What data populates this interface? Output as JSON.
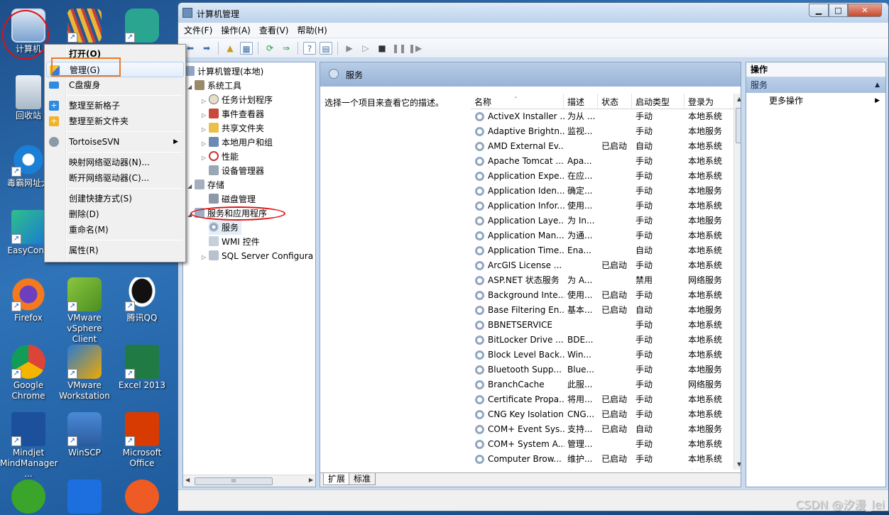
{
  "desktop": {
    "icons": [
      {
        "label": "计算机",
        "name": "computer-icon"
      },
      {
        "label": "",
        "name": "app-bars-icon"
      },
      {
        "label": "",
        "name": "app-green-icon"
      },
      {
        "label": "回收站",
        "name": "recycle-bin-icon"
      },
      {
        "label": "毒霸网址大",
        "name": "ie-browser-icon"
      },
      {
        "label": "EasyConn",
        "name": "easyconnect-icon"
      },
      {
        "label": "Firefox",
        "name": "firefox-icon"
      },
      {
        "label": "VMware vSphere Client",
        "name": "vmware-vsphere-icon"
      },
      {
        "label": "腾讯QQ",
        "name": "qq-icon"
      },
      {
        "label": "Google Chrome",
        "name": "chrome-icon"
      },
      {
        "label": "VMware Workstation",
        "name": "vmware-workstation-icon"
      },
      {
        "label": "Excel 2013",
        "name": "excel-icon"
      },
      {
        "label": "Mindjet MindManager ...",
        "name": "mindmanager-icon"
      },
      {
        "label": "WinSCP",
        "name": "winscp-icon"
      },
      {
        "label": "Microsoft Office",
        "name": "office-icon"
      },
      {
        "label": "",
        "name": "frog-app-icon"
      },
      {
        "label": "",
        "name": "shield-app-icon"
      },
      {
        "label": "",
        "name": "postman-icon"
      }
    ]
  },
  "context_menu": {
    "items": [
      {
        "label": "打开(O)",
        "bold": true
      },
      {
        "label": "管理(G)",
        "highlighted": true
      },
      {
        "label": "C盘瘦身"
      },
      {
        "label": "整理至新格子"
      },
      {
        "label": "整理至新文件夹"
      },
      {
        "label": "TortoiseSVN",
        "submenu": true
      },
      {
        "label": "映射网络驱动器(N)..."
      },
      {
        "label": "断开网络驱动器(C)..."
      },
      {
        "label": "创建快捷方式(S)"
      },
      {
        "label": "删除(D)"
      },
      {
        "label": "重命名(M)"
      },
      {
        "label": "属性(R)"
      }
    ]
  },
  "window": {
    "title": "计算机管理",
    "menu": [
      "文件(F)",
      "操作(A)",
      "查看(V)",
      "帮助(H)"
    ],
    "controls": {
      "minimize": "▁",
      "maximize": "□",
      "close": "✕"
    }
  },
  "tree": {
    "root": "计算机管理(本地)",
    "system_tools": "系统工具",
    "task_scheduler": "任务计划程序",
    "event_viewer": "事件查看器",
    "shared_folders": "共享文件夹",
    "local_users": "本地用户和组",
    "performance": "性能",
    "device_manager": "设备管理器",
    "storage": "存储",
    "disk_management": "磁盘管理",
    "services_apps": "服务和应用程序",
    "services": "服务",
    "wmi": "WMI 控件",
    "sql": "SQL Server Configura",
    "scroll_thumb": "III"
  },
  "services_pane": {
    "header": "服务",
    "description": "选择一个项目来查看它的描述。",
    "columns": [
      "名称",
      "描述",
      "状态",
      "启动类型",
      "登录为"
    ],
    "rows": [
      [
        "ActiveX Installer ...",
        "为从 ...",
        "",
        "手动",
        "本地系统"
      ],
      [
        "Adaptive Brightn...",
        "监视...",
        "",
        "手动",
        "本地服务"
      ],
      [
        "AMD External Ev...",
        "",
        "已启动",
        "自动",
        "本地系统"
      ],
      [
        "Apache Tomcat ...",
        "Apa...",
        "",
        "手动",
        "本地系统"
      ],
      [
        "Application Expe...",
        "在应...",
        "",
        "手动",
        "本地系统"
      ],
      [
        "Application Iden...",
        "确定...",
        "",
        "手动",
        "本地服务"
      ],
      [
        "Application Infor...",
        "使用...",
        "",
        "手动",
        "本地系统"
      ],
      [
        "Application Laye...",
        "为 In...",
        "",
        "手动",
        "本地服务"
      ],
      [
        "Application Man...",
        "为通...",
        "",
        "手动",
        "本地系统"
      ],
      [
        "Application Time...",
        "Ena...",
        "",
        "自动",
        "本地系统"
      ],
      [
        "ArcGIS License ...",
        "",
        "已启动",
        "手动",
        "本地系统"
      ],
      [
        "ASP.NET 状态服务",
        "为 A...",
        "",
        "禁用",
        "网络服务"
      ],
      [
        "Background Inte...",
        "使用...",
        "已启动",
        "手动",
        "本地系统"
      ],
      [
        "Base Filtering En...",
        "基本...",
        "已启动",
        "自动",
        "本地服务"
      ],
      [
        "BBNETSERVICE",
        "",
        "",
        "手动",
        "本地系统"
      ],
      [
        "BitLocker Drive ...",
        "BDE...",
        "",
        "手动",
        "本地系统"
      ],
      [
        "Block Level Back...",
        "Win...",
        "",
        "手动",
        "本地系统"
      ],
      [
        "Bluetooth Supp...",
        "Blue...",
        "",
        "手动",
        "本地服务"
      ],
      [
        "BranchCache",
        "此服...",
        "",
        "手动",
        "网络服务"
      ],
      [
        "Certificate Propa...",
        "将用...",
        "已启动",
        "手动",
        "本地系统"
      ],
      [
        "CNG Key Isolation",
        "CNG...",
        "已启动",
        "手动",
        "本地系统"
      ],
      [
        "COM+ Event Sys...",
        "支持...",
        "已启动",
        "自动",
        "本地服务"
      ],
      [
        "COM+ System A...",
        "管理...",
        "",
        "手动",
        "本地系统"
      ],
      [
        "Computer Brow...",
        "维护...",
        "已启动",
        "手动",
        "本地系统"
      ],
      [
        "Credential M...",
        "为用...",
        "",
        "手动",
        "本地系统"
      ]
    ],
    "tabs": [
      "扩展",
      "标准"
    ]
  },
  "actions_pane": {
    "header": "操作",
    "section": "服务",
    "more": "更多操作"
  },
  "watermark": "CSDN @汐漫_lei"
}
